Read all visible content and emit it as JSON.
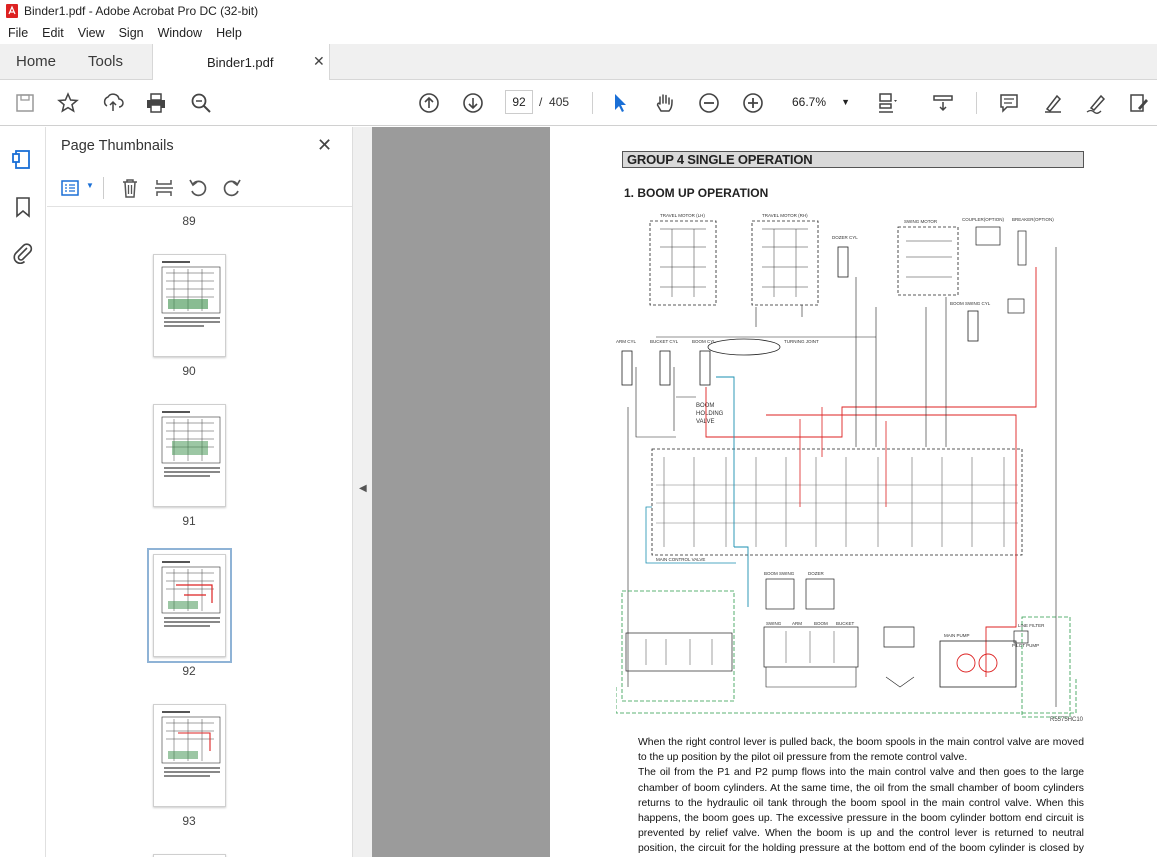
{
  "window": {
    "title": "Binder1.pdf - Adobe Acrobat Pro DC (32-bit)"
  },
  "menu": [
    "File",
    "Edit",
    "View",
    "Sign",
    "Window",
    "Help"
  ],
  "tabs": {
    "home": "Home",
    "tools": "Tools",
    "document": "Binder1.pdf"
  },
  "toolbar": {
    "current_page": "92",
    "page_separator": "/",
    "total_pages": "405",
    "zoom": "66.7%"
  },
  "thumbnail_panel": {
    "title": "Page Thumbnails",
    "page_numbers": [
      "89",
      "90",
      "91",
      "92",
      "93"
    ],
    "selected_page": "92"
  },
  "document": {
    "group_heading": "GROUP 4  SINGLE OPERATION",
    "section_heading": "1. BOOM UP OPERATION",
    "figure_code": "R5575HC10",
    "diagram_labels": {
      "travel_lh": "TRAVEL MOTOR (LH)",
      "travel_rh": "TRAVEL MOTOR (RH)",
      "dozer_cyl": "DOZER CYL",
      "swing_motor": "SWING MOTOR",
      "coupler": "COUPLER(OPTION)",
      "breaker": "BREAKER(OPTION)",
      "boom_swing_cyl": "BOOM SWING CYL",
      "arm_cyl": "ARM CYL",
      "bucket_cyl": "BUCKET CYL",
      "boom_cyl": "BOOM CYL",
      "turning_joint": "TURNING JOINT",
      "boom_holding_1": "BOOM",
      "boom_holding_2": "HOLDING",
      "boom_holding_3": "VALVE",
      "main_control_valve": "MAIN CONTROL VALVE",
      "boom_swing": "BOOM SWING",
      "dozer": "DOZER",
      "swing": "SWING",
      "arm": "ARM",
      "boom": "BOOM",
      "bucket": "BUCKET",
      "main_pump": "MAIN PUMP",
      "pilot_pump": "PILOT PUMP",
      "line_filter": "LINE FILTER"
    },
    "paragraphs": [
      "When the right control lever is pulled back, the boom spools in the main control valve are moved to the up position by the pilot oil pressure from the remote control valve.",
      "The oil from the P1 and P2 pump flows into the main control valve and then goes to the large chamber of boom cylinders.  At the same time, the oil from the small chamber of boom cylinders returns to the hydraulic oil tank through the boom spool in the main control valve.  When this happens, the boom goes up.  The excessive pressure in the boom cylinder bottom end circuit is prevented by relief valve.  When the boom is up and the control lever is returned to neutral position, the circuit for the holding pressure at the bottom end of the boom cylinder is closed by the boom"
    ]
  }
}
